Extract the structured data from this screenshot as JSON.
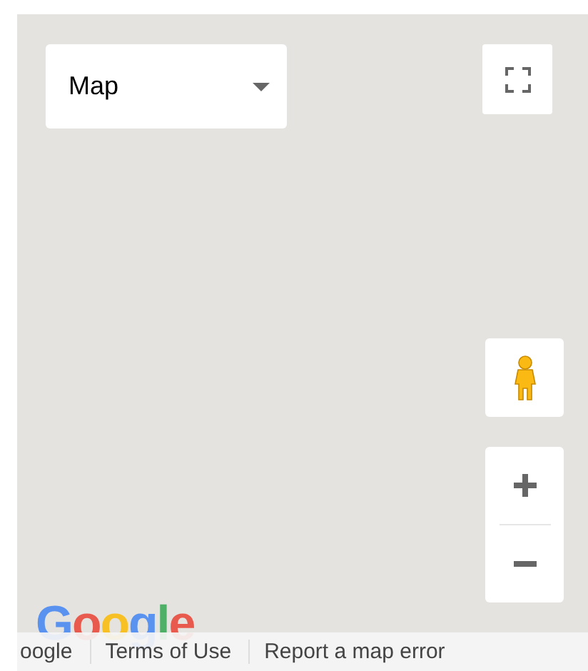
{
  "map_type": {
    "value": "Map"
  },
  "logo": "Google",
  "footer": [
    "oogle",
    "Terms of Use",
    "Report a map error"
  ]
}
